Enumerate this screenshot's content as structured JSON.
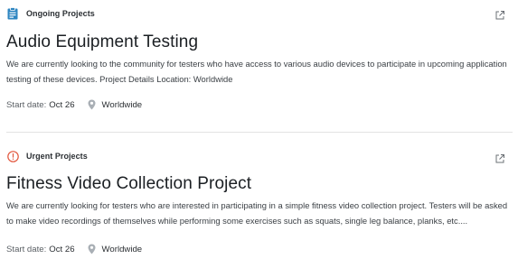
{
  "projects": [
    {
      "category": {
        "label": "Ongoing Projects",
        "icon": "clipboard-icon",
        "color": "#2e86c1"
      },
      "title": "Audio Equipment Testing",
      "description": "We are currently looking to the community for testers who have access to various audio devices to participate in upcoming application testing of these devices. Project Details Location: Worldwide",
      "start_label": "Start date:",
      "start_value": "Oct 26",
      "location": "Worldwide",
      "location_icon": "location-pin-icon",
      "link_icon": "external-link-icon"
    },
    {
      "category": {
        "label": "Urgent Projects",
        "icon": "alert-circle-icon",
        "color": "#e2563d"
      },
      "title": "Fitness Video Collection Project",
      "description": "We are currently looking for testers who are interested in participating in a simple fitness video collection project. Testers will be asked to make video recordings of themselves while performing some exercises such as squats, single leg balance, planks, etc....",
      "start_label": "Start date:",
      "start_value": "Oct 26",
      "location": "Worldwide",
      "location_icon": "location-pin-icon",
      "link_icon": "external-link-icon"
    }
  ]
}
